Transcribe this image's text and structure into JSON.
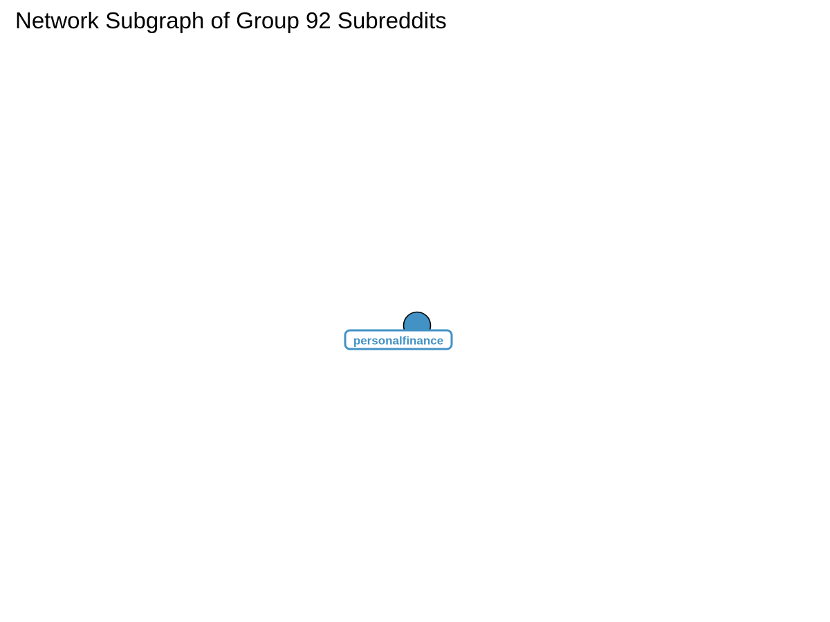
{
  "title": "Network Subgraph of Group 92 Subreddits",
  "colors": {
    "node_fill": "#4292c6",
    "node_stroke": "#000000",
    "label_text": "#4292c6",
    "label_border": "#4292c6",
    "label_background": "#ffffff"
  },
  "nodes": [
    {
      "id": "personalfinance",
      "label": "personalfinance"
    }
  ],
  "edges": []
}
